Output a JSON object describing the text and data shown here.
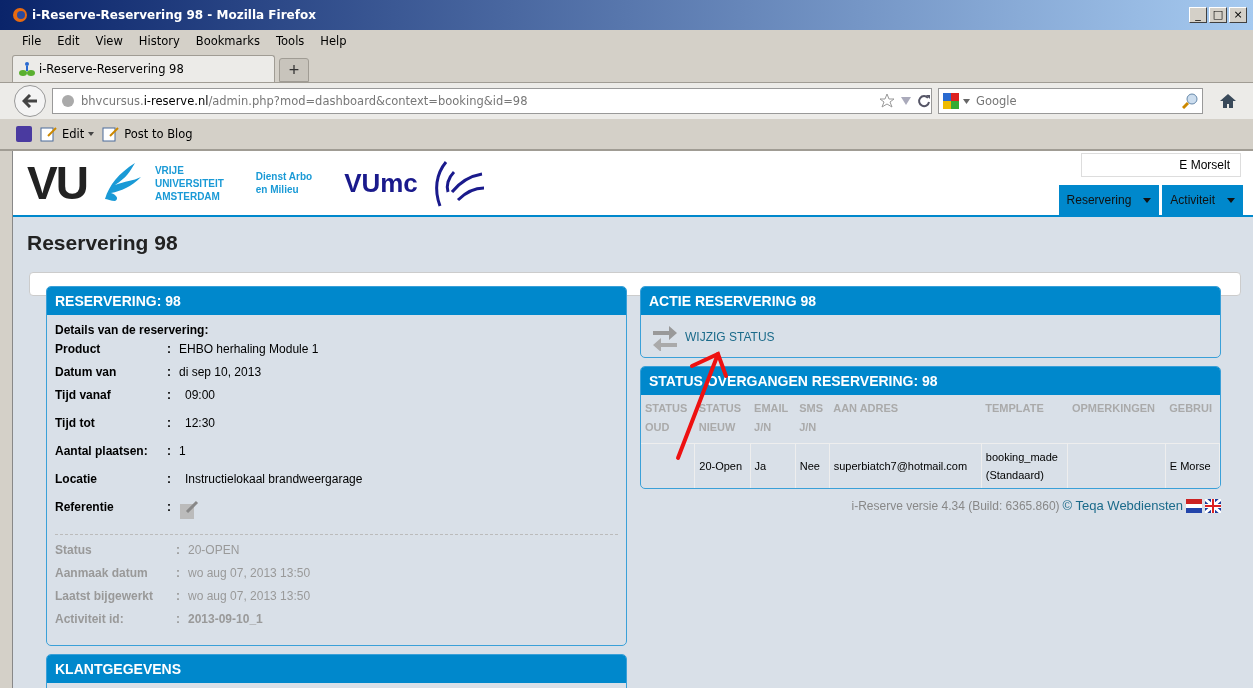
{
  "window": {
    "title": "i-Reserve-Reservering 98 - Mozilla Firefox",
    "controls": [
      "_",
      "□",
      "×"
    ]
  },
  "menu": [
    "File",
    "Edit",
    "View",
    "History",
    "Bookmarks",
    "Tools",
    "Help"
  ],
  "tabs": [
    {
      "label": "i-Reserve-Reservering 98",
      "selected": true
    }
  ],
  "new_tab": "+",
  "address": {
    "prefix": "bhvcursus.",
    "domain": "i-reserve.nl",
    "path": "/admin.php?mod=dashboard&context=booking&id=98"
  },
  "search": {
    "placeholder": "Google"
  },
  "bookmarks": [
    "Edit",
    "Post to Blog"
  ],
  "site": {
    "logo_vu": "VU",
    "logo_vu_lines": [
      "VRIJE",
      "UNIVERSITEIT",
      "AMSTERDAM"
    ],
    "dept_lines": [
      "Dienst Arbo",
      "en Milieu"
    ],
    "logo_vumc": "VUmc",
    "user": "E Morselt",
    "nav": [
      "Reservering",
      "Activiteit"
    ]
  },
  "heading": "Reservering 98",
  "reservation_panel": {
    "title": "RESERVERING: 98",
    "subtitle": "Details van de reservering:",
    "rows": [
      {
        "kind": "text",
        "label": "Product",
        "sep": ":",
        "value": "EHBO herhaling Module 1"
      },
      {
        "kind": "text",
        "label": "Datum van",
        "sep": ":",
        "value": "di sep 10, 2013"
      },
      {
        "kind": "text",
        "label": "Tijd vanaf",
        "sep": ":",
        "value": "09:00"
      },
      {
        "kind": "text",
        "label": "Tijd tot",
        "sep": ":",
        "value": "12:30"
      },
      {
        "kind": "text",
        "label": "Aantal plaatsen:",
        "sep": ":",
        "value": "1"
      },
      {
        "kind": "text",
        "label": "Locatie",
        "sep": ":",
        "value": "Instructielokaal brandweergarage"
      },
      {
        "kind": "icon",
        "label": "Referentie",
        "sep": ":"
      }
    ],
    "meta": [
      {
        "label": "Status",
        "sep": ":",
        "value": "20-OPEN",
        "bold": false
      },
      {
        "label": "Aanmaak datum",
        "sep": ":",
        "value": "wo aug 07, 2013 13:50",
        "bold": false
      },
      {
        "label": "Laatst bijgewerkt",
        "sep": ":",
        "value": "wo aug 07, 2013 13:50",
        "bold": false
      },
      {
        "label": "Activiteit id:",
        "sep": ":",
        "value": "2013-09-10_1",
        "bold": true
      }
    ]
  },
  "customer_panel": {
    "title": "KLANTGEGEVENS"
  },
  "action_panel": {
    "title": "ACTIE RESERVERING 98",
    "action": "WIJZIG STATUS"
  },
  "transitions_panel": {
    "title": "STATUS OVERGANGEN RESERVERING: 98",
    "columns": [
      "STATUS\nOUD",
      "STATUS\nNIEUW",
      "EMAIL\nJ/N",
      "SMS\nJ/N",
      "AAN ADRES",
      "TEMPLATE",
      "OPMERKINGEN",
      "GEBRUI"
    ],
    "rows": [
      [
        null,
        "20-Open",
        "Ja",
        "Nee",
        "superbiatch7@hotmail.com",
        "booking_made\n(Standaard)",
        null,
        "E Morse"
      ]
    ]
  },
  "footer": {
    "version": "i-Reserve versie 4.34 (Build: 6365.860)",
    "link": "© Teqa Webdiensten"
  },
  "annotation": {
    "kind": "arrow"
  }
}
